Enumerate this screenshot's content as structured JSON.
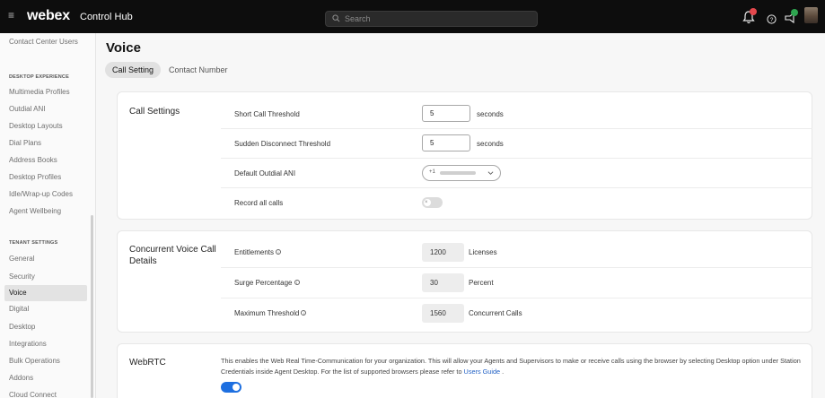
{
  "topbar": {
    "logo": "webex",
    "product": "Control Hub",
    "search_placeholder": "Search",
    "icons": [
      "menu-icon",
      "alerts-icon",
      "help-icon",
      "announcements-icon",
      "user-avatar"
    ]
  },
  "sidebar": {
    "top_item": "Contact Center Users",
    "section_desktop": "DESKTOP EXPERIENCE",
    "desktop_items": [
      "Multimedia Profiles",
      "Outdial ANI",
      "Desktop Layouts",
      "Dial Plans",
      "Address Books",
      "Desktop Profiles",
      "Idle/Wrap-up Codes",
      "Agent Wellbeing"
    ],
    "section_tenant": "TENANT SETTINGS",
    "tenant_items": [
      "General",
      "Security",
      "Voice",
      "Digital",
      "Desktop",
      "Integrations",
      "Bulk Operations",
      "Addons",
      "Cloud Connect"
    ],
    "active_item": "Voice"
  },
  "main": {
    "title": "Voice",
    "tabs": [
      {
        "label": "Call Setting",
        "active": true
      },
      {
        "label": "Contact Number",
        "active": false
      }
    ],
    "call_settings": {
      "title": "Call Settings",
      "short_call_label": "Short Call Threshold",
      "short_call_value": "5",
      "short_call_unit": "seconds",
      "sudden_disconnect_label": "Sudden Disconnect Threshold",
      "sudden_disconnect_value": "5",
      "sudden_disconnect_unit": "seconds",
      "default_outdial_label": "Default Outdial ANI",
      "default_outdial_value": "+1",
      "record_calls_label": "Record all calls",
      "record_calls_on": false
    },
    "concurrent": {
      "title": "Concurrent Voice Call Details",
      "entitlements_label": "Entitlements",
      "entitlements_value": "1200",
      "entitlements_unit": "Licenses",
      "surge_label": "Surge Percentage",
      "surge_value": "30",
      "surge_unit": "Percent",
      "max_label": "Maximum Threshold",
      "max_value": "1560",
      "max_unit": "Concurrent Calls"
    },
    "webrtc": {
      "title": "WebRTC",
      "description": "This enables the Web Real Time-Communication for your organization. This will allow your Agents and Supervisors to make or receive calls using the browser by selecting Desktop option under Station Credentials inside Agent Desktop. For the list of supported browsers please refer to",
      "link_text": "Users Guide",
      "link_suffix": ".",
      "enabled": true
    }
  },
  "colors": {
    "topbar": "#0d0d0d",
    "accent_blue": "#1d6fe0",
    "alert_badge": "#e5484d",
    "announce_badge": "#2ea44f"
  }
}
